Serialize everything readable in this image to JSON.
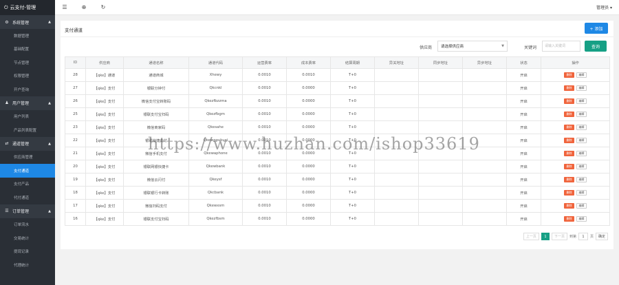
{
  "brand": {
    "title": "云支付-管理",
    "icon": "power-icon"
  },
  "sidebar": {
    "groups": [
      {
        "title": "系统管理",
        "icon": "gear-icon",
        "items": [
          "数据管理",
          "基础配置",
          "节点管理",
          "权限管理",
          "开户查询"
        ]
      },
      {
        "title": "用户管理",
        "icon": "user-icon",
        "items": [
          "用户列表",
          "产品列表配置"
        ]
      },
      {
        "title": "通道管理",
        "icon": "channel-icon",
        "items": [
          "供应商管理",
          "支付通道",
          "支付产品",
          "代付通道"
        ]
      },
      {
        "title": "订单管理",
        "icon": "order-icon",
        "items": [
          "订单流水",
          "交易统计",
          "提现记录",
          "代理统计"
        ]
      }
    ],
    "active_item": "支付通道"
  },
  "topbar": {
    "user": "管理员 ▾"
  },
  "content": {
    "title": "支付通道",
    "add_label": "+ 添加",
    "supplier_label": "供应商",
    "supplier_value": "请选择供应商",
    "keyword_label": "关键词",
    "keyword_placeholder": "请输入关键词",
    "query_label": "查询"
  },
  "table": {
    "headers": [
      "ID",
      "供应商",
      "通道名称",
      "通道代码",
      "运营费率",
      "成本费率",
      "结算周期",
      "异关地址",
      "同步地址",
      "异步地址",
      "状态",
      "操作"
    ],
    "delete_label": "删除",
    "edit_label": "编辑",
    "rows": [
      [
        "28",
        "【qke】通道",
        "通道商城",
        "Xhewy",
        "0.0010",
        "0.0010",
        "T+0",
        "",
        "",
        "",
        "开启"
      ],
      [
        "27",
        "【qke】支付",
        "银联分钟付",
        "Qkcnkl",
        "0.0010",
        "0.0000",
        "T+0",
        "",
        "",
        "",
        "开启"
      ],
      [
        "26",
        "【qke】支付",
        "微信支付宝转账码",
        "Qkezfbzzma",
        "0.0010",
        "0.0000",
        "T+0",
        "",
        "",
        "",
        "开启"
      ],
      [
        "25",
        "【qke】支付",
        "银联支付宝扫码",
        "Qkezfbgm",
        "0.0010",
        "0.0000",
        "T+0",
        "",
        "",
        "",
        "开启"
      ],
      [
        "23",
        "【qke】支付",
        "微信商家码",
        "Qkesahe",
        "0.0010",
        "0.0000",
        "T+0",
        "",
        "",
        "",
        "开启"
      ],
      [
        "22",
        "【qke】支付",
        "银联快捷支付",
        "Qkewpoukuai",
        "0.0010",
        "0.0000",
        "T+0",
        "",
        "",
        "",
        "开启"
      ],
      [
        "21",
        "【qke】支付",
        "微信手机支付",
        "Qkewaphone",
        "0.0010",
        "0.0000",
        "T+0",
        "",
        "",
        "",
        "开启"
      ],
      [
        "20",
        "【qke】支付",
        "银联网银快捷卡",
        "Qkewbank",
        "0.0010",
        "0.0000",
        "T+0",
        "",
        "",
        "",
        "开启"
      ],
      [
        "19",
        "【qke】支付",
        "微信云闪付",
        "Qkeysf",
        "0.0010",
        "0.0000",
        "T+0",
        "",
        "",
        "",
        "开启"
      ],
      [
        "18",
        "【qke】支付",
        "银联银行卡转账",
        "Qkcbank",
        "0.0010",
        "0.0000",
        "T+0",
        "",
        "",
        "",
        "开启"
      ],
      [
        "17",
        "【qke】支付",
        "微信扫码支付",
        "Qkewxsm",
        "0.0010",
        "0.0000",
        "T+0",
        "",
        "",
        "",
        "开启"
      ],
      [
        "16",
        "【qke】支付",
        "银联支付宝扫码",
        "Qkezfbsm",
        "0.0010",
        "0.0000",
        "T+0",
        "",
        "",
        "",
        "开启"
      ]
    ]
  },
  "pager": {
    "prev": "上一页",
    "current": "1",
    "next": "下一页",
    "goto_label": "到第",
    "page_input": "1",
    "page_unit": "页",
    "confirm": "确定"
  },
  "watermark": "https://www.huzhan.com/ishop33619"
}
